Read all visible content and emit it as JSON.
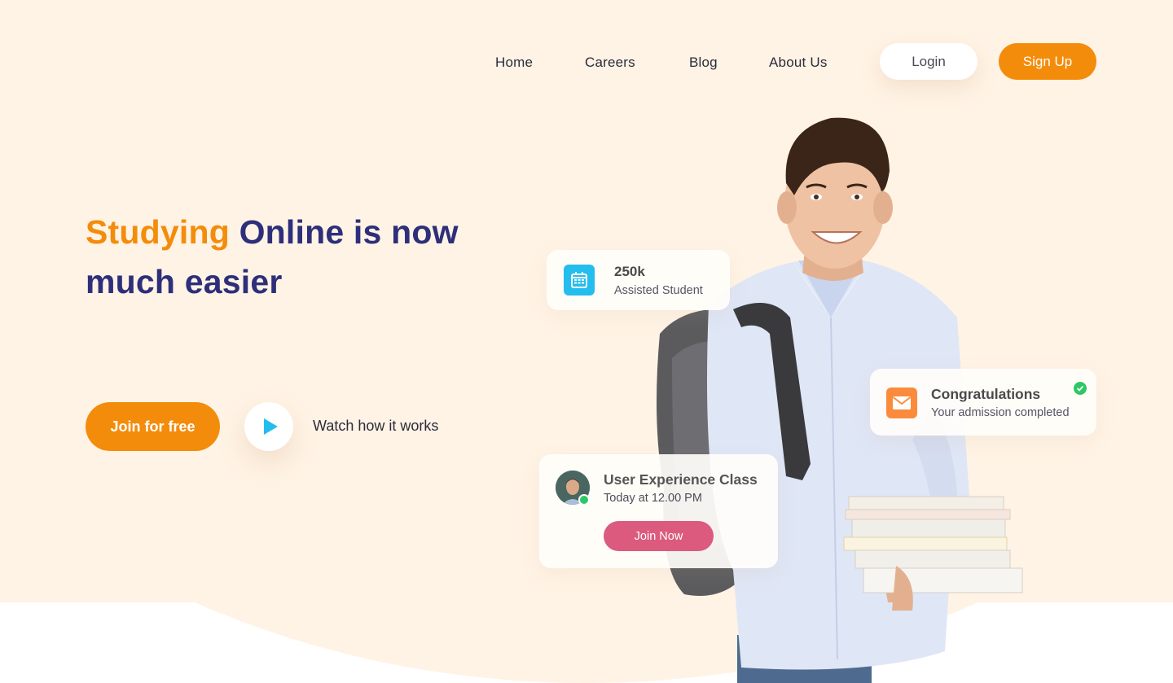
{
  "nav": {
    "links": [
      "Home",
      "Careers",
      "Blog",
      "About Us"
    ],
    "login_label": "Login",
    "signup_label": "Sign Up"
  },
  "hero": {
    "headline_accent": "Studying",
    "headline_rest_line1": " Online is now",
    "headline_line2": "much easier",
    "join_label": "Join for free",
    "watch_label": "Watch how it works"
  },
  "cards": {
    "stats": {
      "icon": "calendar-icon",
      "value": "250k",
      "label": "Assisted Student"
    },
    "congrats": {
      "icon": "mail-icon",
      "title": "Congratulations",
      "subtitle": "Your admission completed",
      "status_icon": "check-circle-icon"
    },
    "class": {
      "title": "User Experience Class",
      "time": "Today at 12.00 PM",
      "button_label": "Join Now",
      "presence": "online"
    }
  },
  "colors": {
    "accent_orange": "#f48c0b",
    "headline_navy": "#2e2f7a",
    "hero_background": "#fff3e5",
    "calendar_blue": "#23bdee",
    "mail_orange": "#fb8b3c",
    "join_now_pink": "#dc5a7e",
    "online_green": "#2fc766"
  }
}
